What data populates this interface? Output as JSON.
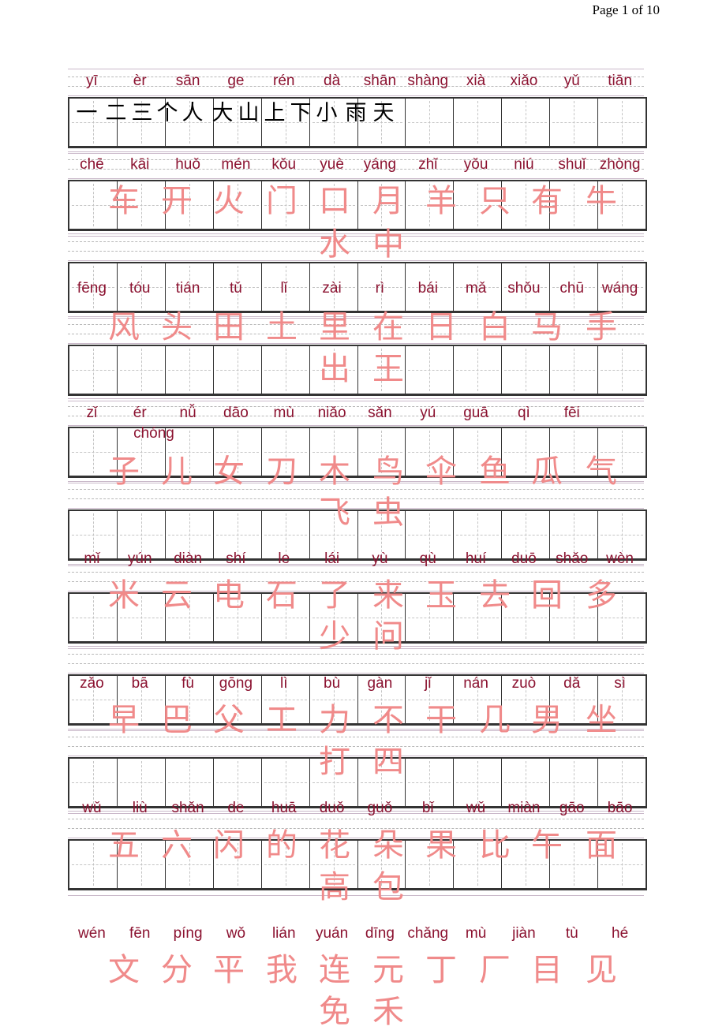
{
  "header": {
    "page_indicator": "Page 1 of 10"
  },
  "grid": {
    "rows": 10,
    "cells_per_row": 12
  },
  "colors": {
    "pinyin": "#8b1230",
    "hanzi_pink": "#f08a8a",
    "hanzi_black": "#000000",
    "box_border": "#333333"
  },
  "blocks": [
    {
      "pinyin": [
        "yī",
        "èr",
        "sān",
        "ge",
        "rén",
        "dà",
        "shān",
        "shàng",
        "xià",
        "xiǎo",
        "yǔ",
        "tiān"
      ],
      "hanzi_lines": [
        [
          "一",
          "二",
          "三",
          "个",
          "人",
          "大",
          "山",
          "上",
          "下",
          "小",
          "雨",
          "天"
        ]
      ],
      "style": "black"
    },
    {
      "pinyin": [
        "chē",
        "kāi",
        "huǒ",
        "mén",
        "kǒu",
        "yuè",
        "yáng",
        "zhǐ",
        "yǒu",
        "niú",
        "shuǐ",
        "zhòng"
      ],
      "hanzi_lines": [
        [
          "车",
          "开",
          "火",
          "门",
          "口",
          "月",
          "羊",
          "只",
          "有",
          "牛"
        ],
        [
          "水",
          "中"
        ]
      ],
      "style": "pink"
    },
    {
      "pinyin": [
        "fēng",
        "tóu",
        "tián",
        "tǔ",
        "lǐ",
        "zài",
        "rì",
        "bái",
        "mǎ",
        "shǒu",
        "chū",
        "wáng"
      ],
      "hanzi_lines": [
        [
          "风",
          "头",
          "田",
          "土",
          "里",
          "在",
          "日",
          "白",
          "马",
          "手"
        ],
        [
          "出",
          "王"
        ]
      ],
      "style": "pink"
    },
    {
      "pinyin": [
        "zǐ",
        "ér",
        "nǚ",
        "dāo",
        "mù",
        "niǎo",
        "sǎn",
        "yú",
        "guā",
        "qì",
        "fēi",
        "chóng"
      ],
      "hanzi_lines": [
        [
          "子",
          "儿",
          "女",
          "刀",
          "木",
          "鸟",
          "伞",
          "鱼",
          "瓜",
          "气"
        ],
        [
          "飞",
          "虫"
        ]
      ],
      "style": "pink"
    },
    {
      "pinyin": [
        "mǐ",
        "yún",
        "diàn",
        "shí",
        "le",
        "lái",
        "yù",
        "qù",
        "huí",
        "duō",
        "shǎo",
        "wèn"
      ],
      "hanzi_lines": [
        [
          "米",
          "云",
          "电",
          "石",
          "了",
          "来",
          "玉",
          "去",
          "回",
          "多"
        ],
        [
          "少",
          "问"
        ]
      ],
      "style": "pink"
    },
    {
      "pinyin": [
        "zǎo",
        "bā",
        "fù",
        "gōng",
        "lì",
        "bù",
        "gàn",
        "jǐ",
        "nán",
        "zuò",
        "dǎ",
        "sì"
      ],
      "hanzi_lines": [
        [
          "早",
          "巴",
          "父",
          "工",
          "力",
          "不",
          "干",
          "几",
          "男",
          "坐"
        ],
        [
          "打",
          "四"
        ]
      ],
      "style": "pink"
    },
    {
      "pinyin": [
        "wǔ",
        "liù",
        "shǎn",
        "de",
        "huā",
        "duǒ",
        "guǒ",
        "bǐ",
        "wǔ",
        "miàn",
        "gāo",
        "bāo"
      ],
      "hanzi_lines": [
        [
          "五",
          "六",
          "闪",
          "的",
          "花",
          "朵",
          "果",
          "比",
          "午",
          "面"
        ],
        [
          "高",
          "包"
        ]
      ],
      "style": "pink"
    },
    {
      "pinyin": [
        "wén",
        "fēn",
        "píng",
        "wǒ",
        "lián",
        "yuán",
        "dīng",
        "chǎng",
        "mù",
        "jiàn",
        "tù",
        "hé"
      ],
      "hanzi_lines": [
        [
          "文",
          "分",
          "平",
          "我",
          "连",
          "元",
          "丁",
          "厂",
          "目",
          "见"
        ],
        [
          "免",
          "禾"
        ]
      ],
      "style": "pink"
    }
  ]
}
